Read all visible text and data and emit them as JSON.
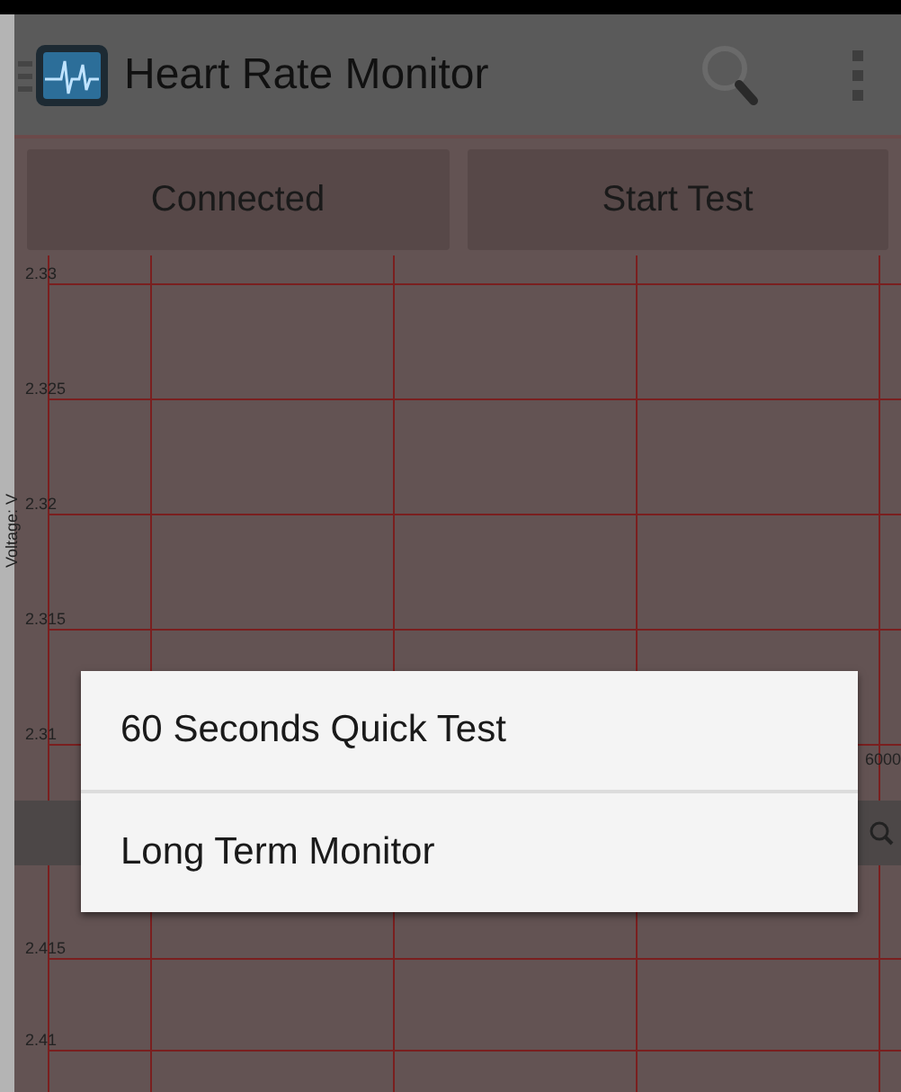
{
  "app_bar": {
    "title": "Heart Rate Monitor"
  },
  "buttons": [
    {
      "label": "Connected"
    },
    {
      "label": "Start Test"
    }
  ],
  "top_chart": {
    "ylabel": "Voltage: V",
    "ytick_labels": [
      "2.33",
      "2.325",
      "2.32",
      "2.315",
      "2.31"
    ],
    "xtick_label": "6000"
  },
  "bottom_chart": {
    "ytick_labels": [
      "2.415",
      "2.41"
    ]
  },
  "dialog": {
    "items": [
      {
        "label": "60 Seconds Quick Test"
      },
      {
        "label": "Long Term Monitor"
      }
    ]
  }
}
